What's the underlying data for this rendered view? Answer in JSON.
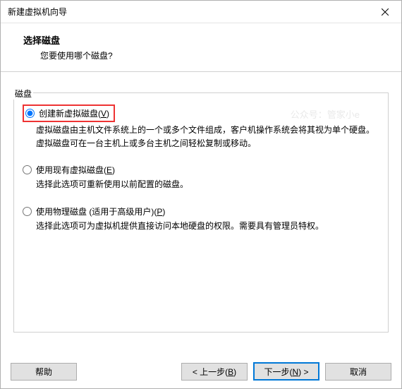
{
  "window": {
    "title": "新建虚拟机向导"
  },
  "header": {
    "title": "选择磁盘",
    "subtitle": "您要使用哪个磁盘?"
  },
  "group": {
    "label": "磁盘",
    "watermark": "公众号：管家小e"
  },
  "options": [
    {
      "label_pre": "创建新虚拟磁盘(",
      "mnemonic": "V",
      "label_post": ")",
      "desc": "虚拟磁盘由主机文件系统上的一个或多个文件组成，客户机操作系统会将其视为单个硬盘。虚拟磁盘可在一台主机上或多台主机之间轻松复制或移动。",
      "checked": true,
      "highlighted": true
    },
    {
      "label_pre": "使用现有虚拟磁盘(",
      "mnemonic": "E",
      "label_post": ")",
      "desc": "选择此选项可重新使用以前配置的磁盘。",
      "checked": false,
      "highlighted": false
    },
    {
      "label_pre": "使用物理磁盘 (适用于高级用户)(",
      "mnemonic": "P",
      "label_post": ")",
      "desc": "选择此选项可为虚拟机提供直接访问本地硬盘的权限。需要具有管理员特权。",
      "checked": false,
      "highlighted": false
    }
  ],
  "buttons": {
    "help": "帮助",
    "back_pre": "< 上一步(",
    "back_m": "B",
    "back_post": ")",
    "next_pre": "下一步(",
    "next_m": "N",
    "next_post": ") >",
    "cancel": "取消"
  }
}
